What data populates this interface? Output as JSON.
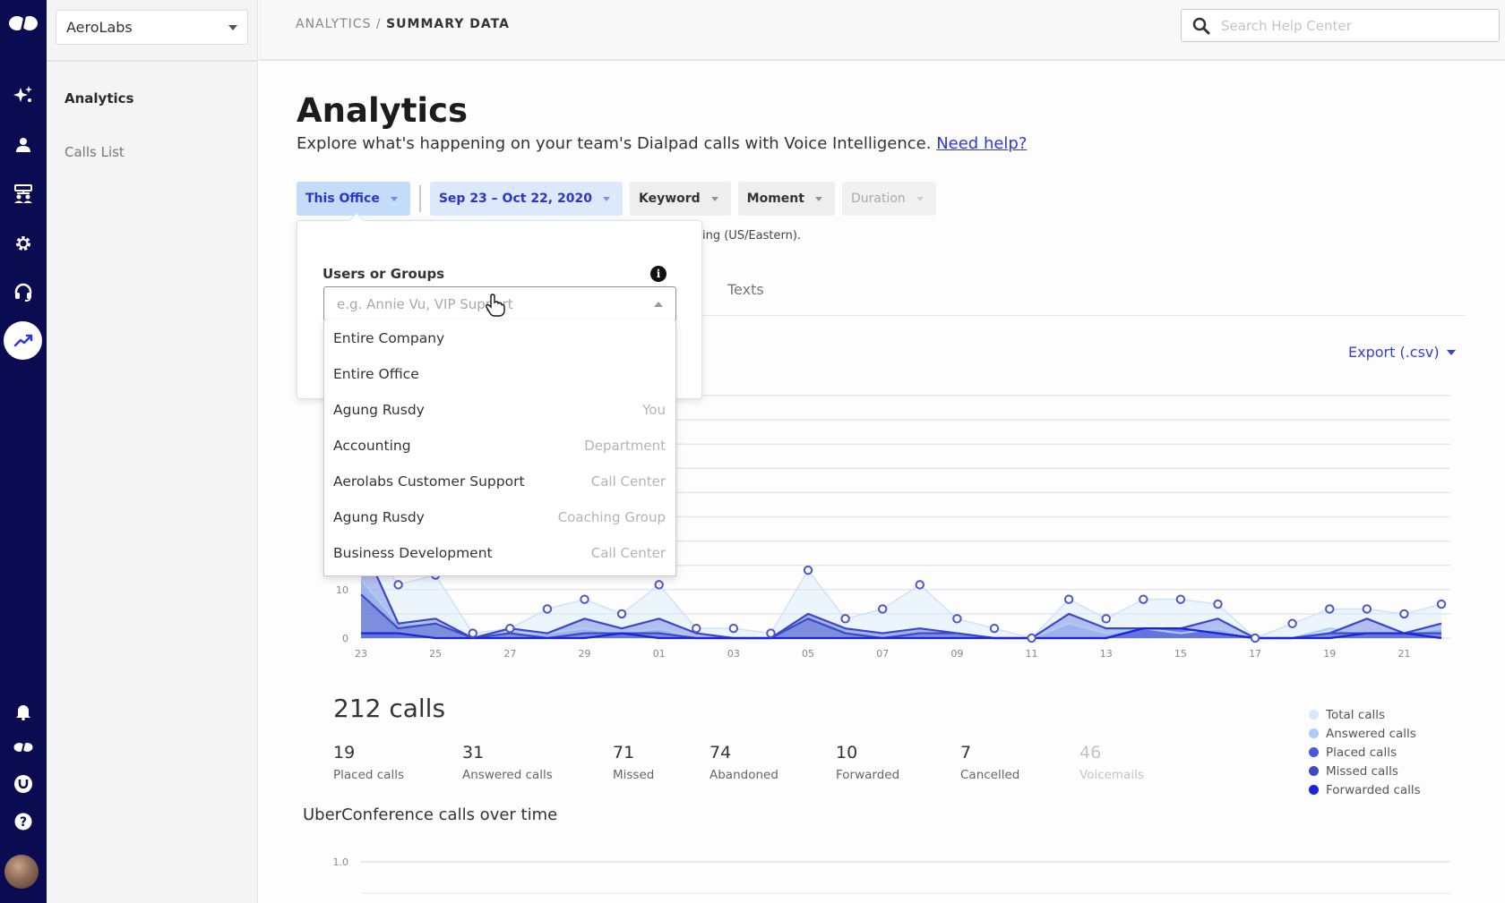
{
  "org_selector": {
    "value": "AeroLabs"
  },
  "sidebar": {
    "items": [
      {
        "label": "Analytics",
        "active": true
      },
      {
        "label": "Calls List",
        "active": false
      }
    ]
  },
  "rail": {
    "top_icons": [
      "dialpad-logo-icon",
      "sparkles-icon",
      "person-icon",
      "org-chart-icon",
      "gear-icon",
      "headset-icon",
      "analytics-trend-icon"
    ],
    "bottom_icons": [
      "bell-icon",
      "dialpad-small-icon",
      "uberconference-icon",
      "help-icon",
      "avatar"
    ]
  },
  "header": {
    "breadcrumb_parent": "ANALYTICS",
    "breadcrumb_separator": " / ",
    "breadcrumb_current": "SUMMARY DATA",
    "search_placeholder": "Search Help Center"
  },
  "page": {
    "title": "Analytics",
    "subtitle": "Explore what's happening on your team's Dialpad calls with Voice Intelligence.",
    "help_link": "Need help?",
    "timezone_note": "ing (US/Eastern).",
    "tab_texts": "Texts",
    "export_label": "Export (.csv)"
  },
  "filters": [
    {
      "label": "This Office",
      "style": "office"
    },
    {
      "label": "Sep 23 – Oct 22, 2020",
      "style": "date"
    },
    {
      "label": "Keyword",
      "style": "grey"
    },
    {
      "label": "Moment",
      "style": "grey"
    },
    {
      "label": "Duration",
      "style": "disabled"
    }
  ],
  "popover": {
    "label": "Users or Groups",
    "input_placeholder": "e.g. Annie Vu, VIP Support",
    "input_value": "",
    "options": [
      {
        "name": "Entire Company",
        "type": ""
      },
      {
        "name": "Entire Office",
        "type": ""
      },
      {
        "name": "Agung Rusdy",
        "type": "You"
      },
      {
        "name": "Accounting",
        "type": "Department"
      },
      {
        "name": "Aerolabs Customer Support",
        "type": "Call Center"
      },
      {
        "name": "Agung Rusdy",
        "type": "Coaching Group"
      },
      {
        "name": "Business Development",
        "type": "Call Center"
      }
    ]
  },
  "summary": {
    "total": "212 calls",
    "stats": [
      {
        "value": "19",
        "label": "Placed calls",
        "dim": false
      },
      {
        "value": "31",
        "label": "Answered calls",
        "dim": false
      },
      {
        "value": "71",
        "label": "Missed",
        "dim": false
      },
      {
        "value": "74",
        "label": "Abandoned",
        "dim": false
      },
      {
        "value": "10",
        "label": "Forwarded",
        "dim": false
      },
      {
        "value": "7",
        "label": "Cancelled",
        "dim": false
      },
      {
        "value": "46",
        "label": "Voicemails",
        "dim": true
      }
    ]
  },
  "uberconference": {
    "title": "UberConference calls over time",
    "y_tick": "1.0"
  },
  "colors": {
    "rail_bg": "#0b0b52",
    "accent": "#3540d6",
    "total": "#d6e8fb",
    "answered": "#a9cdf5",
    "placed": "#4a58d6",
    "missed": "#3e4ac4",
    "forwarded": "#1a23e0"
  },
  "chart_data": {
    "type": "area",
    "title": "",
    "xlabel": "",
    "ylabel": "",
    "ylim": [
      0,
      50
    ],
    "y_ticks": [
      "0",
      "10"
    ],
    "x_tick_labels": [
      "23",
      "25",
      "27",
      "29",
      "01",
      "03",
      "05",
      "07",
      "09",
      "11",
      "13",
      "15",
      "17",
      "19",
      "21"
    ],
    "x": [
      "Sep 23",
      "Sep 24",
      "Sep 25",
      "Sep 26",
      "Sep 27",
      "Sep 28",
      "Sep 29",
      "Sep 30",
      "Oct 01",
      "Oct 02",
      "Oct 03",
      "Oct 04",
      "Oct 05",
      "Oct 06",
      "Oct 07",
      "Oct 08",
      "Oct 09",
      "Oct 10",
      "Oct 11",
      "Oct 12",
      "Oct 13",
      "Oct 14",
      "Oct 15",
      "Oct 16",
      "Oct 17",
      "Oct 18",
      "Oct 19",
      "Oct 20",
      "Oct 21",
      "Oct 22"
    ],
    "legend": [
      "Total calls",
      "Answered calls",
      "Placed calls",
      "Missed calls",
      "Forwarded calls"
    ],
    "legend_position": "bottom-right",
    "series": [
      {
        "name": "Total calls",
        "values": [
          22,
          11,
          13,
          1,
          2,
          6,
          8,
          5,
          11,
          2,
          2,
          1,
          14,
          4,
          6,
          11,
          4,
          2,
          0,
          8,
          4,
          8,
          8,
          7,
          0,
          3,
          6,
          6,
          5,
          7
        ]
      },
      {
        "name": "Answered calls",
        "values": [
          12,
          3,
          3,
          0,
          1,
          1,
          2,
          1,
          2,
          0,
          0,
          0,
          5,
          2,
          1,
          2,
          1,
          0,
          0,
          3,
          1,
          2,
          1,
          2,
          0,
          0,
          2,
          1,
          1,
          2
        ]
      },
      {
        "name": "Placed calls",
        "values": [
          20,
          3,
          4,
          0,
          2,
          1,
          4,
          2,
          4,
          1,
          0,
          0,
          5,
          2,
          1,
          2,
          1,
          0,
          0,
          5,
          2,
          2,
          2,
          4,
          0,
          0,
          1,
          4,
          1,
          3
        ]
      },
      {
        "name": "Missed calls",
        "values": [
          9,
          2,
          3,
          0,
          1,
          0,
          1,
          1,
          1,
          0,
          0,
          0,
          4,
          1,
          0,
          1,
          1,
          0,
          0,
          0,
          0,
          2,
          2,
          1,
          0,
          0,
          1,
          1,
          1,
          1
        ]
      },
      {
        "name": "Forwarded calls",
        "values": [
          1,
          1,
          0,
          0,
          0,
          0,
          0,
          1,
          0,
          0,
          0,
          0,
          0,
          0,
          0,
          0,
          0,
          0,
          0,
          0,
          0,
          2,
          2,
          1,
          0,
          0,
          0,
          1,
          1,
          0
        ]
      }
    ],
    "grid": true
  }
}
